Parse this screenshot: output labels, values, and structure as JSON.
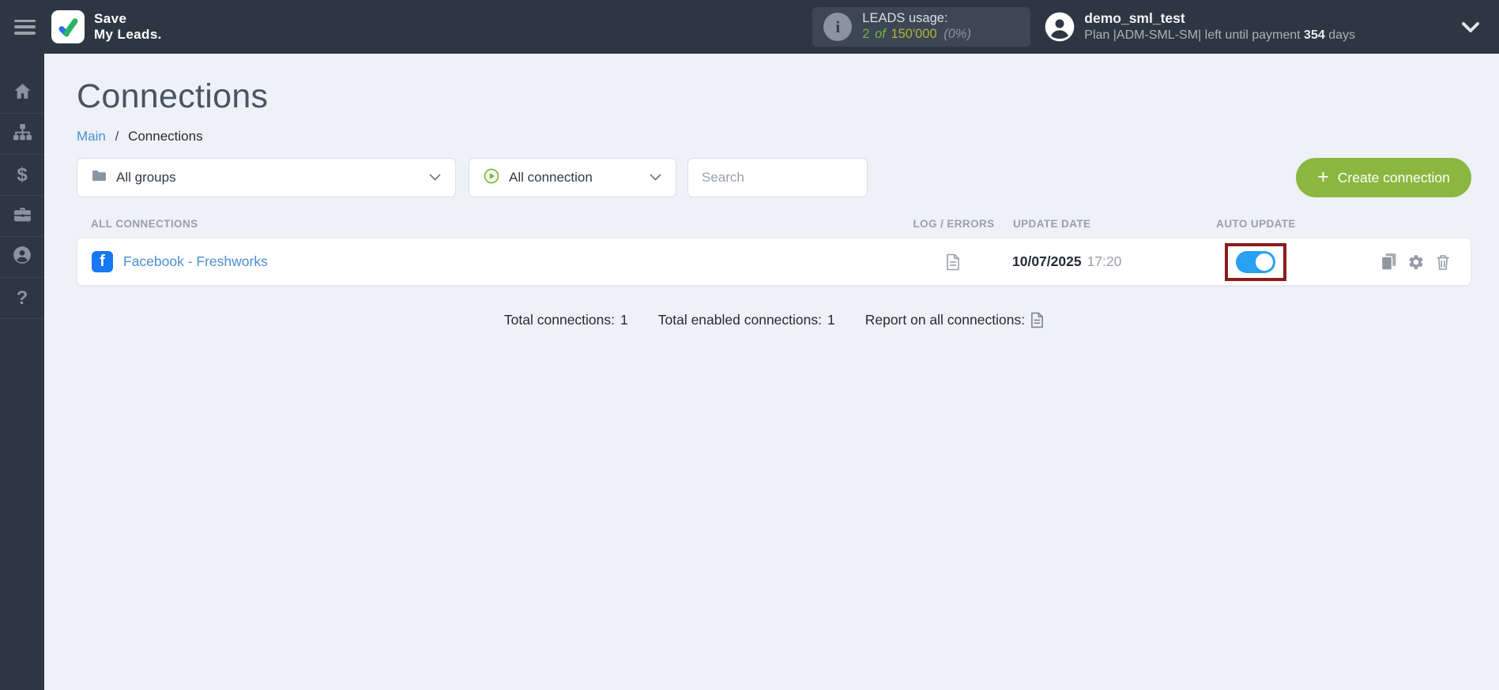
{
  "header": {
    "logo": {
      "line1": "Save",
      "line2": "My Leads."
    },
    "leads_usage": {
      "info_glyph": "i",
      "label": "LEADS usage:",
      "used": "2",
      "of_word": "of",
      "quota": "150'000",
      "percent": "(0%)"
    },
    "user": {
      "name": "demo_sml_test",
      "plan_prefix": "Plan |ADM-SML-SM| left until payment",
      "days": "354",
      "days_suffix": "days"
    }
  },
  "sidebar": {
    "items": [
      {
        "icon": "home-icon"
      },
      {
        "icon": "connections-tree-icon"
      },
      {
        "icon": "payments-dollar-icon",
        "glyph": "$"
      },
      {
        "icon": "services-briefcase-icon"
      },
      {
        "icon": "account-person-icon"
      },
      {
        "icon": "help-icon",
        "glyph": "?"
      }
    ]
  },
  "main": {
    "title": "Connections",
    "breadcrumb": {
      "main": "Main",
      "separator": "/",
      "current": "Connections"
    },
    "filters": {
      "groups_value": "All groups",
      "connection_value": "All connection",
      "search_placeholder": "Search"
    },
    "create_button": {
      "plus_glyph": "+",
      "label": "Create connection"
    },
    "table": {
      "headers": {
        "all_connections": "ALL CONNECTIONS",
        "log_errors": "LOG / ERRORS",
        "update_date": "UPDATE DATE",
        "auto_update": "AUTO UPDATE"
      },
      "row": {
        "source_icon_glyph": "f",
        "name": "Facebook - Freshworks",
        "date": "10/07/2025",
        "time": "17:20",
        "auto_update_on": true
      }
    },
    "summary": {
      "total_label": "Total connections:",
      "total_value": "1",
      "enabled_label": "Total enabled connections:",
      "enabled_value": "1",
      "report_label": "Report on all connections:"
    }
  },
  "colors": {
    "header_bg": "#2d3743",
    "accent_green": "#8bb741",
    "link_blue": "#4a90d2",
    "toggle_blue": "#2aa0f4",
    "annotation_red": "#8c1c1c",
    "facebook_blue": "#1877f2",
    "usage_used_green": "#76b33c",
    "usage_quota_yellow": "#b2b43a"
  }
}
